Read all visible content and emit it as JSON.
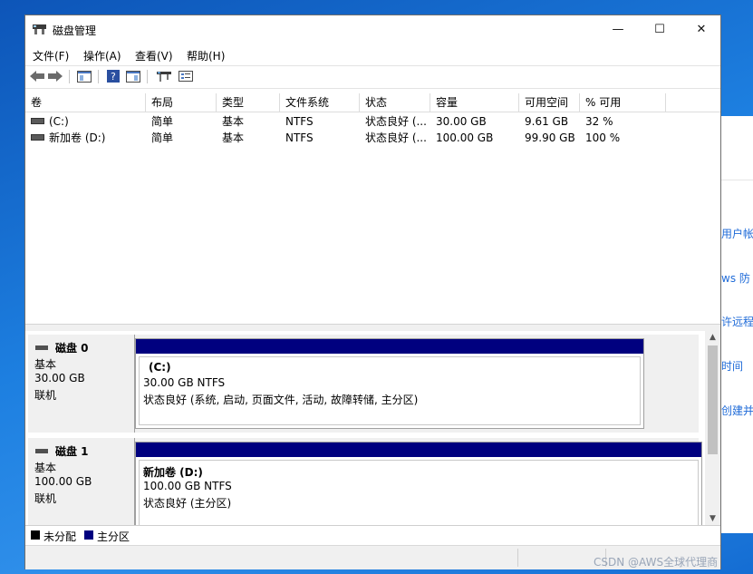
{
  "window": {
    "title": "磁盘管理",
    "controls": {
      "minimize": "—",
      "maximize": "☐",
      "close": "✕"
    }
  },
  "menu": [
    "文件(F)",
    "操作(A)",
    "查看(V)",
    "帮助(H)"
  ],
  "toolbar": {
    "icons": [
      "back-icon",
      "forward-icon",
      "console-tree-icon",
      "help-icon",
      "properties-icon",
      "connect-icon",
      "settings-icon"
    ]
  },
  "volume_table": {
    "columns": [
      "卷",
      "布局",
      "类型",
      "文件系统",
      "状态",
      "容量",
      "可用空间",
      "% 可用"
    ],
    "rows": [
      {
        "name": "(C:)",
        "layout": "简单",
        "type": "基本",
        "fs": "NTFS",
        "status": "状态良好 (...",
        "capacity": "30.00 GB",
        "free": "9.61 GB",
        "pct": "32 %"
      },
      {
        "name": "新加卷 (D:)",
        "layout": "简单",
        "type": "基本",
        "fs": "NTFS",
        "status": "状态良好 (...",
        "capacity": "100.00 GB",
        "free": "99.90 GB",
        "pct": "100 %"
      }
    ]
  },
  "disks": [
    {
      "name": "磁盘 0",
      "kind": "基本",
      "size": "30.00 GB",
      "state": "联机",
      "partition": {
        "title": "(C:)",
        "size_fs": "30.00 GB NTFS",
        "status": "状态良好 (系统, 启动, 页面文件, 活动, 故障转储, 主分区)"
      }
    },
    {
      "name": "磁盘 1",
      "kind": "基本",
      "size": "100.00 GB",
      "state": "联机",
      "partition": {
        "title": "新加卷  (D:)",
        "size_fs": "100.00 GB NTFS",
        "status": "状态良好 (主分区)"
      }
    }
  ],
  "legend": [
    {
      "label": "未分配",
      "color": "#000000"
    },
    {
      "label": "主分区",
      "color": "#00007f"
    }
  ],
  "background_window": {
    "links": [
      "用户帐",
      "ws 防",
      "许远程",
      "时间",
      "创建并"
    ]
  },
  "watermark": "CSDN @AWS全球代理商"
}
